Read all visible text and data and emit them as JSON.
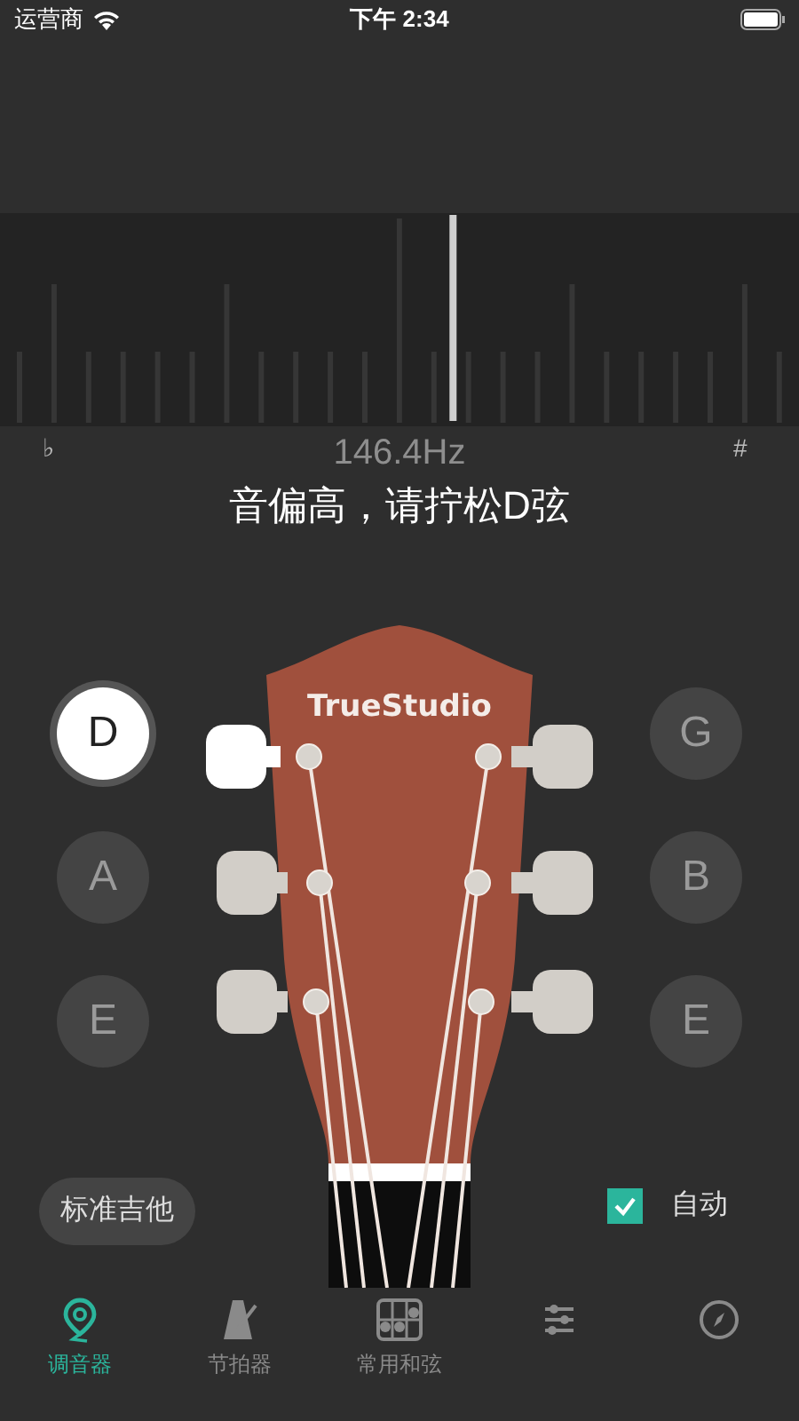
{
  "status_bar": {
    "carrier": "运营商",
    "time": "下午 2:34"
  },
  "meter": {
    "flat_label": "♭",
    "sharp_label": "#",
    "level": 0.567
  },
  "frequency": "146.4Hz",
  "message": "音偏高，请拧松D弦",
  "headstock": {
    "brand": "TrueStudio"
  },
  "left_strings": [
    {
      "note": "D",
      "selected": true
    },
    {
      "note": "A",
      "selected": false
    },
    {
      "note": "E",
      "selected": false
    }
  ],
  "right_strings": [
    {
      "note": "G",
      "selected": false
    },
    {
      "note": "B",
      "selected": false
    },
    {
      "note": "E",
      "selected": false
    }
  ],
  "tuning_preset": "标准吉他",
  "auto": {
    "label": "自动",
    "checked": true
  },
  "tabs": [
    {
      "label": "调音器",
      "selected": true
    },
    {
      "label": "节拍器",
      "selected": false
    },
    {
      "label": "常用和弦",
      "selected": false
    },
    {
      "selected": false
    },
    {
      "selected": false
    }
  ]
}
